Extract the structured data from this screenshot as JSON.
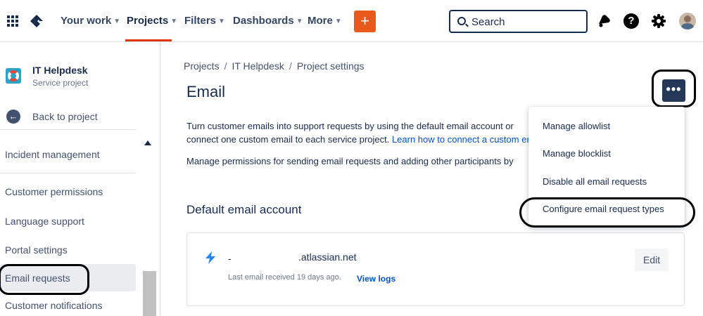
{
  "topnav": {
    "items": [
      {
        "label": "Your work"
      },
      {
        "label": "Projects"
      },
      {
        "label": "Filters"
      },
      {
        "label": "Dashboards"
      },
      {
        "label": "More"
      }
    ],
    "create_label": "+",
    "search_placeholder": "Search",
    "help_label": "?"
  },
  "sidebar": {
    "project_name": "IT Helpdesk",
    "project_type": "Service project",
    "back_label": "Back to project",
    "items": [
      {
        "label": "Incident management"
      },
      {
        "label": "Customer permissions"
      },
      {
        "label": "Language support"
      },
      {
        "label": "Portal settings"
      },
      {
        "label": "Email requests"
      },
      {
        "label": "Customer notifications"
      }
    ]
  },
  "breadcrumb": {
    "items": [
      "Projects",
      "IT Helpdesk",
      "Project settings"
    ],
    "separator": "/"
  },
  "page": {
    "title": "Email",
    "more_label": "•••",
    "para1_line1": "Turn customer emails into support requests by using the default email account or",
    "para1_line2": "connect one custom email to each service project.",
    "para1_link": "Learn how to connect a custom email",
    "para2": "Manage permissions for sending email requests and adding other participants by",
    "section_title": "Default email account"
  },
  "email_card": {
    "prefix": "-",
    "domain": ".atlassian.net",
    "last_email": "Last email received 19 days ago.",
    "view_logs": "View logs",
    "edit_label": "Edit"
  },
  "menu": {
    "items": [
      {
        "label": "Manage allowlist"
      },
      {
        "label": "Manage blocklist"
      },
      {
        "label": "Disable all email requests"
      },
      {
        "label": "Configure email request types"
      }
    ]
  },
  "colors": {
    "accent": "#de350b",
    "create_button": "#e9591c",
    "more_button": "#253858",
    "link": "#0052cc",
    "text": "#172b4d"
  },
  "icons": [
    "app-switcher-icon",
    "jira-logo-icon",
    "chevron-down-icon",
    "search-icon",
    "notifications-icon",
    "help-icon",
    "settings-icon",
    "avatar",
    "project-icon",
    "back-arrow-icon",
    "lightning-icon"
  ]
}
